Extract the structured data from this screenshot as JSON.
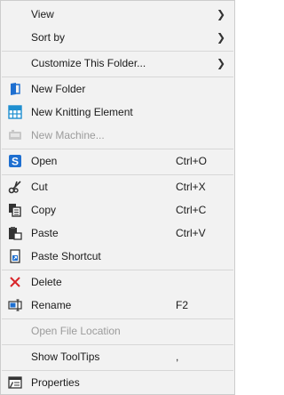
{
  "menu": {
    "view": {
      "label": "View",
      "icon": "none"
    },
    "sort_by": {
      "label": "Sort by",
      "icon": "none"
    },
    "customize_folder": {
      "label": "Customize This Folder...",
      "icon": "none"
    },
    "new_folder": {
      "label": "New Folder",
      "icon": "folder-icon"
    },
    "new_knitting_element": {
      "label": "New Knitting Element",
      "icon": "knitting-grid-icon"
    },
    "new_machine": {
      "label": "New Machine...",
      "icon": "machine-icon",
      "disabled": true
    },
    "open": {
      "label": "Open",
      "shortcut": "Ctrl+O",
      "icon": "open-app-icon"
    },
    "cut": {
      "label": "Cut",
      "shortcut": "Ctrl+X",
      "icon": "scissors-icon"
    },
    "copy": {
      "label": "Copy",
      "shortcut": "Ctrl+C",
      "icon": "copy-icon"
    },
    "paste": {
      "label": "Paste",
      "shortcut": "Ctrl+V",
      "icon": "paste-icon"
    },
    "paste_shortcut": {
      "label": "Paste Shortcut",
      "icon": "paste-shortcut-icon"
    },
    "delete": {
      "label": "Delete",
      "icon": "delete-x-icon"
    },
    "rename": {
      "label": "Rename",
      "shortcut": "F2",
      "icon": "rename-icon"
    },
    "open_file_location": {
      "label": "Open File Location",
      "disabled": true
    },
    "show_tooltips": {
      "label": "Show ToolTips",
      "shortcut": ","
    },
    "properties": {
      "label": "Properties",
      "icon": "properties-icon"
    }
  },
  "colors": {
    "accent_blue": "#1e6fd0",
    "delete_red": "#d9252a",
    "disabled_text": "#9b9b9b"
  }
}
